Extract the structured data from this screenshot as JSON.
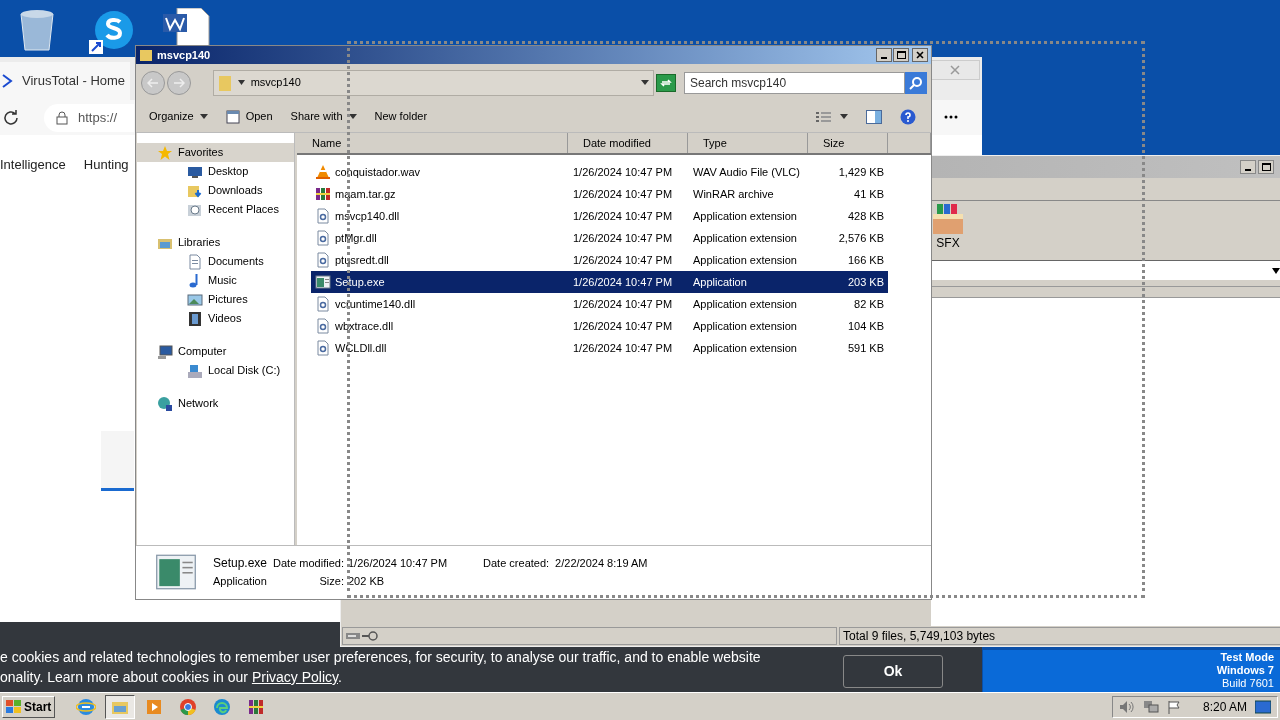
{
  "browser": {
    "tab_title": "VirusTotal - Home",
    "address": "https://",
    "nav": [
      "Intelligence",
      "Hunting"
    ],
    "cookie_banner": {
      "line1": "e cookies and related technologies to remember user preferences, for security, to analyse our traffic, and to enable website",
      "line2": "onality. Learn more about cookies in our ",
      "link": "Privacy Policy",
      "line2_end": ".",
      "button": "Ok"
    }
  },
  "explorer": {
    "title": "msvcp140",
    "breadcrumb": "msvcp140",
    "search": {
      "placeholder": "Search msvcp140"
    },
    "toolbar": [
      {
        "label": "Organize",
        "kind": "menu"
      },
      {
        "label": "Open",
        "kind": "icon"
      },
      {
        "label": "Share with",
        "kind": "menu"
      },
      {
        "label": "New folder",
        "kind": "plain"
      }
    ],
    "nav": [
      {
        "label": "Favorites",
        "kind": "star",
        "selected": true,
        "children": [
          {
            "label": "Desktop",
            "kind": "desktop",
            "selected": false
          },
          {
            "label": "Downloads",
            "kind": "downloads",
            "selected": false
          },
          {
            "label": "Recent Places",
            "kind": "recent",
            "selected": false
          }
        ]
      },
      {
        "label": "Libraries",
        "kind": "library",
        "selected": false,
        "children": [
          {
            "label": "Documents",
            "kind": "documents",
            "selected": false
          },
          {
            "label": "Music",
            "kind": "music",
            "selected": false
          },
          {
            "label": "Pictures",
            "kind": "pictures",
            "selected": false
          },
          {
            "label": "Videos",
            "kind": "videos",
            "selected": false
          }
        ]
      },
      {
        "label": "Computer",
        "kind": "computer",
        "selected": false,
        "children": [
          {
            "label": "Local Disk (C:)",
            "kind": "disk",
            "selected": false
          }
        ]
      },
      {
        "label": "Network",
        "kind": "network",
        "selected": false
      }
    ],
    "columns": [
      "Name",
      "Date modified",
      "Type",
      "Size"
    ],
    "rows": [
      {
        "name": "conquistador.wav",
        "date": "1/26/2024 10:47 PM",
        "type": "WAV Audio File (VLC)",
        "size": "1,429 KB",
        "kind": "vlc",
        "selected": false
      },
      {
        "name": "maam.tar.gz",
        "date": "1/26/2024 10:47 PM",
        "type": "WinRAR archive",
        "size": "41 KB",
        "kind": "rar",
        "selected": false
      },
      {
        "name": "msvcp140.dll",
        "date": "1/26/2024 10:47 PM",
        "type": "Application extension",
        "size": "428 KB",
        "kind": "dll",
        "selected": false
      },
      {
        "name": "ptMgr.dll",
        "date": "1/26/2024 10:47 PM",
        "type": "Application extension",
        "size": "2,576 KB",
        "kind": "dll",
        "selected": false
      },
      {
        "name": "ptusredt.dll",
        "date": "1/26/2024 10:47 PM",
        "type": "Application extension",
        "size": "166 KB",
        "kind": "dll",
        "selected": false
      },
      {
        "name": "Setup.exe",
        "date": "1/26/2024 10:47 PM",
        "type": "Application",
        "size": "203 KB",
        "kind": "exe",
        "selected": true
      },
      {
        "name": "vcruntime140.dll",
        "date": "1/26/2024 10:47 PM",
        "type": "Application extension",
        "size": "82 KB",
        "kind": "dll",
        "selected": false
      },
      {
        "name": "wbxtrace.dll",
        "date": "1/26/2024 10:47 PM",
        "type": "Application extension",
        "size": "104 KB",
        "kind": "dll",
        "selected": false
      },
      {
        "name": "WCLDll.dll",
        "date": "1/26/2024 10:47 PM",
        "type": "Application extension",
        "size": "591 KB",
        "kind": "dll",
        "selected": false
      }
    ],
    "details": {
      "name": "Setup.exe",
      "type": "Application",
      "fields": [
        {
          "label": "Date modified:",
          "value": "1/26/2024 10:47 PM"
        },
        {
          "label": "Size:",
          "value": "202 KB"
        },
        {
          "label": "Date created:",
          "value": "2/22/2024 8:19 AM"
        }
      ]
    }
  },
  "winrar": {
    "toolbar": [
      "SFX"
    ],
    "status": "Total 9 files, 5,749,103 bytes"
  },
  "os_notice": [
    "Test Mode",
    "Windows 7",
    "Build 7601"
  ],
  "taskbar": {
    "start": "Start",
    "apps": [
      {
        "kind": "ie",
        "selected": false
      },
      {
        "kind": "folder",
        "selected": true
      },
      {
        "kind": "media",
        "selected": false
      },
      {
        "kind": "chrome",
        "selected": false
      },
      {
        "kind": "edge",
        "selected": false
      },
      {
        "kind": "rar",
        "selected": false
      }
    ],
    "clock": "8:20 AM"
  }
}
